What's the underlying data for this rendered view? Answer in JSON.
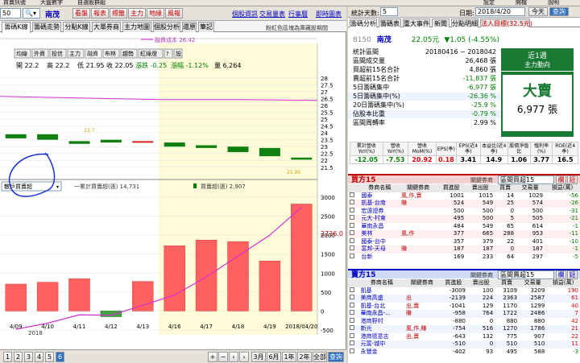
{
  "top": {
    "menu1": "買賣訊號",
    "menu2": "大盤數字",
    "menu3": "自選股群組",
    "r1": "設定",
    "r2": "開檔",
    "r3": "說明"
  },
  "left": {
    "period": "50",
    "stock": "南茂",
    "tool_btns": [
      "看盤",
      "報表",
      "標籤",
      "主力",
      "地緣",
      "風報"
    ],
    "links": [
      "個股資訊",
      "交易量表",
      "行事曆",
      "即時圖表"
    ],
    "tabs": [
      "籌碼K線",
      "籌碼走勢",
      "分點K線",
      "大單券商",
      "主力地圖",
      "個股分析",
      "還原",
      "筆記"
    ],
    "right_note": "粉紅色區塊為庫藏股期間",
    "cost_label": "融資成本 26.42",
    "sub_tabs": [
      "均線",
      "外資",
      "投信",
      "主力",
      "融資",
      "布林",
      "趨勢",
      "紅綠燈",
      "?",
      "設"
    ],
    "ohlc": {
      "open": "開 22.2",
      "high": "高 22.2",
      "low": "低 21.95",
      "close": "收 22.05",
      "change": "漲跌 -0.25",
      "pct": "漲幅 -1.12%",
      "vol": "量 6,264"
    },
    "kprice_note": "23.7",
    "klow_note": "21.95",
    "select2": "散戶買賣超",
    "legend1": "一累計買賣超(張) 14,731",
    "legend2": "買賣超(張) 2,907",
    "last_val": "2736.0",
    "dates": [
      "4/09",
      "4/10",
      "4/11",
      "4/12",
      "4/13",
      "4/16",
      "4/17",
      "4/18",
      "4/19",
      "2018/04/20"
    ],
    "year": "2018",
    "pages": [
      "1",
      "2",
      "3",
      "4",
      "5",
      "6"
    ],
    "bottom_btns": [
      "3月",
      "6月",
      "1年",
      "2年",
      "全部",
      "查詢"
    ]
  },
  "chart_data": [
    {
      "type": "bar",
      "title": "K線",
      "ylim": [
        20.9,
        28.4
      ],
      "yticks": [
        "28",
        "27.5",
        "27",
        "26.5",
        "26",
        "25.5",
        "25",
        "24.5",
        "24",
        "23.5",
        "23",
        "22.5",
        "22",
        "21.5"
      ],
      "candles": [
        {
          "o": 23.9,
          "c": 23.6
        },
        {
          "o": 23.9,
          "c": 23.5
        },
        {
          "o": 23.4,
          "c": 23.2
        },
        {
          "o": 23.5,
          "c": 23.3
        },
        {
          "o": 23.3,
          "c": 23.4
        },
        {
          "o": 23.3,
          "c": 23.0
        },
        {
          "o": 23.1,
          "c": 22.9
        },
        {
          "o": 23.0,
          "c": 22.6
        },
        {
          "o": 22.9,
          "c": 22.3
        },
        {
          "o": 22.2,
          "c": 22.05
        }
      ],
      "cost_line": 26.42
    },
    {
      "type": "bar",
      "title": "散戶買賣超",
      "ylim": [
        -500,
        3000
      ],
      "yticks": [
        "3000",
        "2500",
        "2000",
        "1500",
        "1000",
        "500",
        "0",
        "-500"
      ],
      "categories": [
        "4/09",
        "4/10",
        "4/11",
        "4/12",
        "4/13",
        "4/16",
        "4/17",
        "4/18",
        "4/19",
        "2018/04/20"
      ],
      "values": [
        710,
        760,
        850,
        -150,
        780,
        1720,
        1870,
        1830,
        1320,
        2820
      ],
      "cumulative": [
        -480,
        -320,
        -100,
        -110,
        150,
        420,
        900,
        1450,
        2000,
        2736
      ]
    }
  ],
  "right": {
    "days_label": "統計天數:",
    "days": "5",
    "date_label": "日期:",
    "date": "2018/4/20",
    "today": "今天",
    "query": "查詢",
    "tabs": [
      "籌碼分析",
      "籌碼表",
      "重大事件",
      "新聞",
      "分點明細",
      "法人目標(32.5元)"
    ],
    "code": "8150",
    "name": "南茂",
    "price": "22.05元",
    "chg": "▼1.05 (-4.55%)",
    "rows": [
      [
        "統計區間",
        "20180416 ~ 2018042"
      ],
      [
        "區間成交量",
        "26,468 張"
      ],
      [
        "買超前15名合計",
        "4,860 張"
      ],
      [
        "賣超前15名合計",
        "-11,837 張"
      ],
      [
        "5日籌碼集中",
        "-6,977 張"
      ],
      [
        "5日籌碼集中(%)",
        "-26.36 %"
      ],
      [
        "20日籌碼集中(%)",
        "-25.9 %"
      ],
      [
        "佔股本比重",
        "-0.79 %"
      ],
      [
        "區間周轉率",
        "2.99 %"
      ]
    ],
    "box_title": "近1週",
    "box_sub": "主力動向",
    "box_big": "大賣",
    "box_val": "6,977 張",
    "fin_head": [
      "累計營收YoY(%)",
      "營收YoY(%)",
      "營收MoM(%)",
      "EPS(季)",
      "EPS(近4季)",
      "本益比(近4季)",
      "股價淨值比",
      "殖利率(%)",
      "ROE(近4季)"
    ],
    "fin_vals": [
      "-12.05",
      "-7.53",
      "20.92",
      "0.18",
      "3.41",
      "14.9",
      "1.06",
      "3.77",
      "16.5"
    ],
    "buy_title": "買方15",
    "buy_hint": "關鍵券商",
    "buy_sel": "區間買超15",
    "btn_list": "欄",
    "btn_x": "鈕",
    "cols": [
      "券商名稱",
      "關鍵券商",
      "買進股",
      "賣出股",
      "買賣",
      "交易量",
      "損益(萬)"
    ],
    "buy_rows": [
      [
        "國泰",
        "風,作,賣",
        "1001",
        "1015",
        "14",
        "1029",
        "-56"
      ],
      [
        "凱基-台南",
        "賺",
        "524",
        "549",
        "25",
        "574",
        "-26"
      ],
      [
        "宏遠證券",
        "",
        "500",
        "500",
        "0",
        "500",
        "-31"
      ],
      [
        "元大-村東",
        "",
        "495",
        "500",
        "5",
        "505",
        "-21"
      ],
      [
        "華南永昌",
        "",
        "484",
        "549",
        "65",
        "614",
        "-1"
      ],
      [
        "美林",
        "風,作",
        "377",
        "665",
        "288",
        "953",
        "-11"
      ],
      [
        "國泰-台中",
        "",
        "357",
        "379",
        "22",
        "401",
        "-10"
      ],
      [
        "富邦-天母",
        "賺",
        "187",
        "187",
        "0",
        "187",
        "-1"
      ],
      [
        "台新",
        "",
        "169",
        "233",
        "64",
        "297",
        "-5"
      ]
    ],
    "sell_title": "賣方15",
    "sell_sel": "區間賣超15",
    "sell_rows": [
      [
        "凱基",
        "",
        "-3009",
        "100",
        "3109",
        "3209",
        "190"
      ],
      [
        "美商高盛",
        "出",
        "-2139",
        "224",
        "2363",
        "2587",
        "61"
      ],
      [
        "凱基-台北",
        "出,賣",
        "-1041",
        "129",
        "1170",
        "1299",
        "40"
      ],
      [
        "華南永昌-...",
        "賺",
        "-958",
        "764",
        "1722",
        "2486",
        "7"
      ],
      [
        "港商野村",
        "",
        "-880",
        "0",
        "880",
        "880",
        "42"
      ],
      [
        "新光",
        "風,作,賺",
        "-754",
        "516",
        "1270",
        "1786",
        "21"
      ],
      [
        "港商德意志",
        "出,賣",
        "-643",
        "132",
        "775",
        "907",
        "22"
      ],
      [
        "元富-城中",
        "",
        "-510",
        "0",
        "510",
        "510",
        "11"
      ],
      [
        "永豐金",
        "",
        "-402",
        "93",
        "495",
        "588",
        "-3"
      ]
    ]
  }
}
